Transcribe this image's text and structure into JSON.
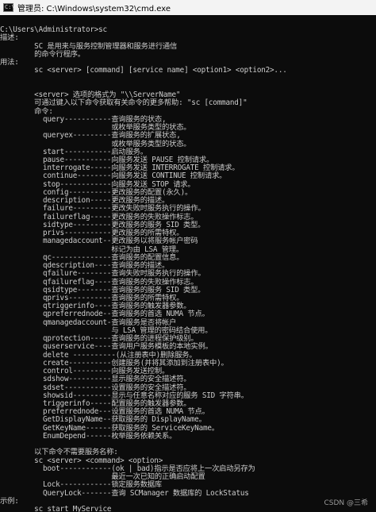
{
  "window": {
    "icon_text": "C:\\",
    "title": "管理员: C:\\Windows\\system32\\cmd.exe"
  },
  "console": {
    "lines": [
      "",
      "C:\\Users\\Administrator>sc",
      "描述:",
      "        SC 是用来与服务控制管理器和服务进行通信",
      "        的命令行程序。",
      "用法:",
      "        sc <server> [command] [service name] <option1> <option2>...",
      "",
      "",
      "        <server> 选项的格式为 \"\\\\ServerName\"",
      "        可通过键入以下命令获取有关命令的更多帮助: \"sc [command]\"",
      "        命令:",
      "          query-----------查询服务的状态,",
      "                          或枚举服务类型的状态。",
      "          queryex---------查询服务的扩展状态,",
      "                          或枚举服务类型的状态。",
      "          start-----------启动服务。",
      "          pause-----------向服务发送 PAUSE 控制请求。",
      "          interrogate-----向服务发送 INTERROGATE 控制请求。",
      "          continue--------向服务发送 CONTINUE 控制请求。",
      "          stop------------向服务发送 STOP 请求。",
      "          config----------更改服务的配置(永久)。",
      "          description-----更改服务的描述。",
      "          failure---------更改失败时服务执行的操作。",
      "          failureflag-----更改服务的失败操作标志。",
      "          sidtype---------更改服务的服务 SID 类型。",
      "          privs-----------更改服务的所需特权。",
      "          managedaccount--更改服务以将服务帐户密码",
      "                          标记为由 LSA 管理。",
      "          qc--------------查询服务的配置信息。",
      "          qdescription----查询服务的描述。",
      "          qfailure--------查询失败时服务执行的操作。",
      "          qfailureflag----查询服务的失败操作标志。",
      "          qsidtype--------查询服务的服务 SID 类型。",
      "          qprivs----------查询服务的所需特权。",
      "          qtriggerinfo----查询服务的触发器参数。",
      "          qpreferrednode--查询服务的首选 NUMA 节点。",
      "          qmanagedaccount-查询服务是否将帐户",
      "                          与 LSA 管理的密码结合使用。",
      "          qprotection-----查询服务的进程保护级别。",
      "          quserservice----查询用户服务模板的本地实例。",
      "          delete ----------(从注册表中)删除服务。",
      "          create----------创建服务(并将其添加到注册表中)。",
      "          control---------向服务发送控制。",
      "          sdshow----------显示服务的安全描述符。",
      "          sdset-----------设置服务的安全描述符。",
      "          showsid---------显示与任意名称对应的服务 SID 字符串。",
      "          triggerinfo-----配置服务的触发器参数。",
      "          preferrednode---设置服务的首选 NUMA 节点。",
      "          GetDisplayName--获取服务的 DisplayName。",
      "          GetKeyName------获取服务的 ServiceKeyName。",
      "          EnumDepend------枚举服务依赖关系。",
      "",
      "        以下命令不需要服务名称:",
      "        sc <server> <command> <option>",
      "          boot------------(ok | bad)指示是否应将上一次启动另存为",
      "                          最近一次已知的正确启动配置",
      "          Lock------------锁定服务数据库",
      "          QueryLock-------查询 SCManager 数据库的 LockStatus",
      "示例:",
      "        sc start MyService"
    ]
  },
  "watermark": "CSDN @三希"
}
